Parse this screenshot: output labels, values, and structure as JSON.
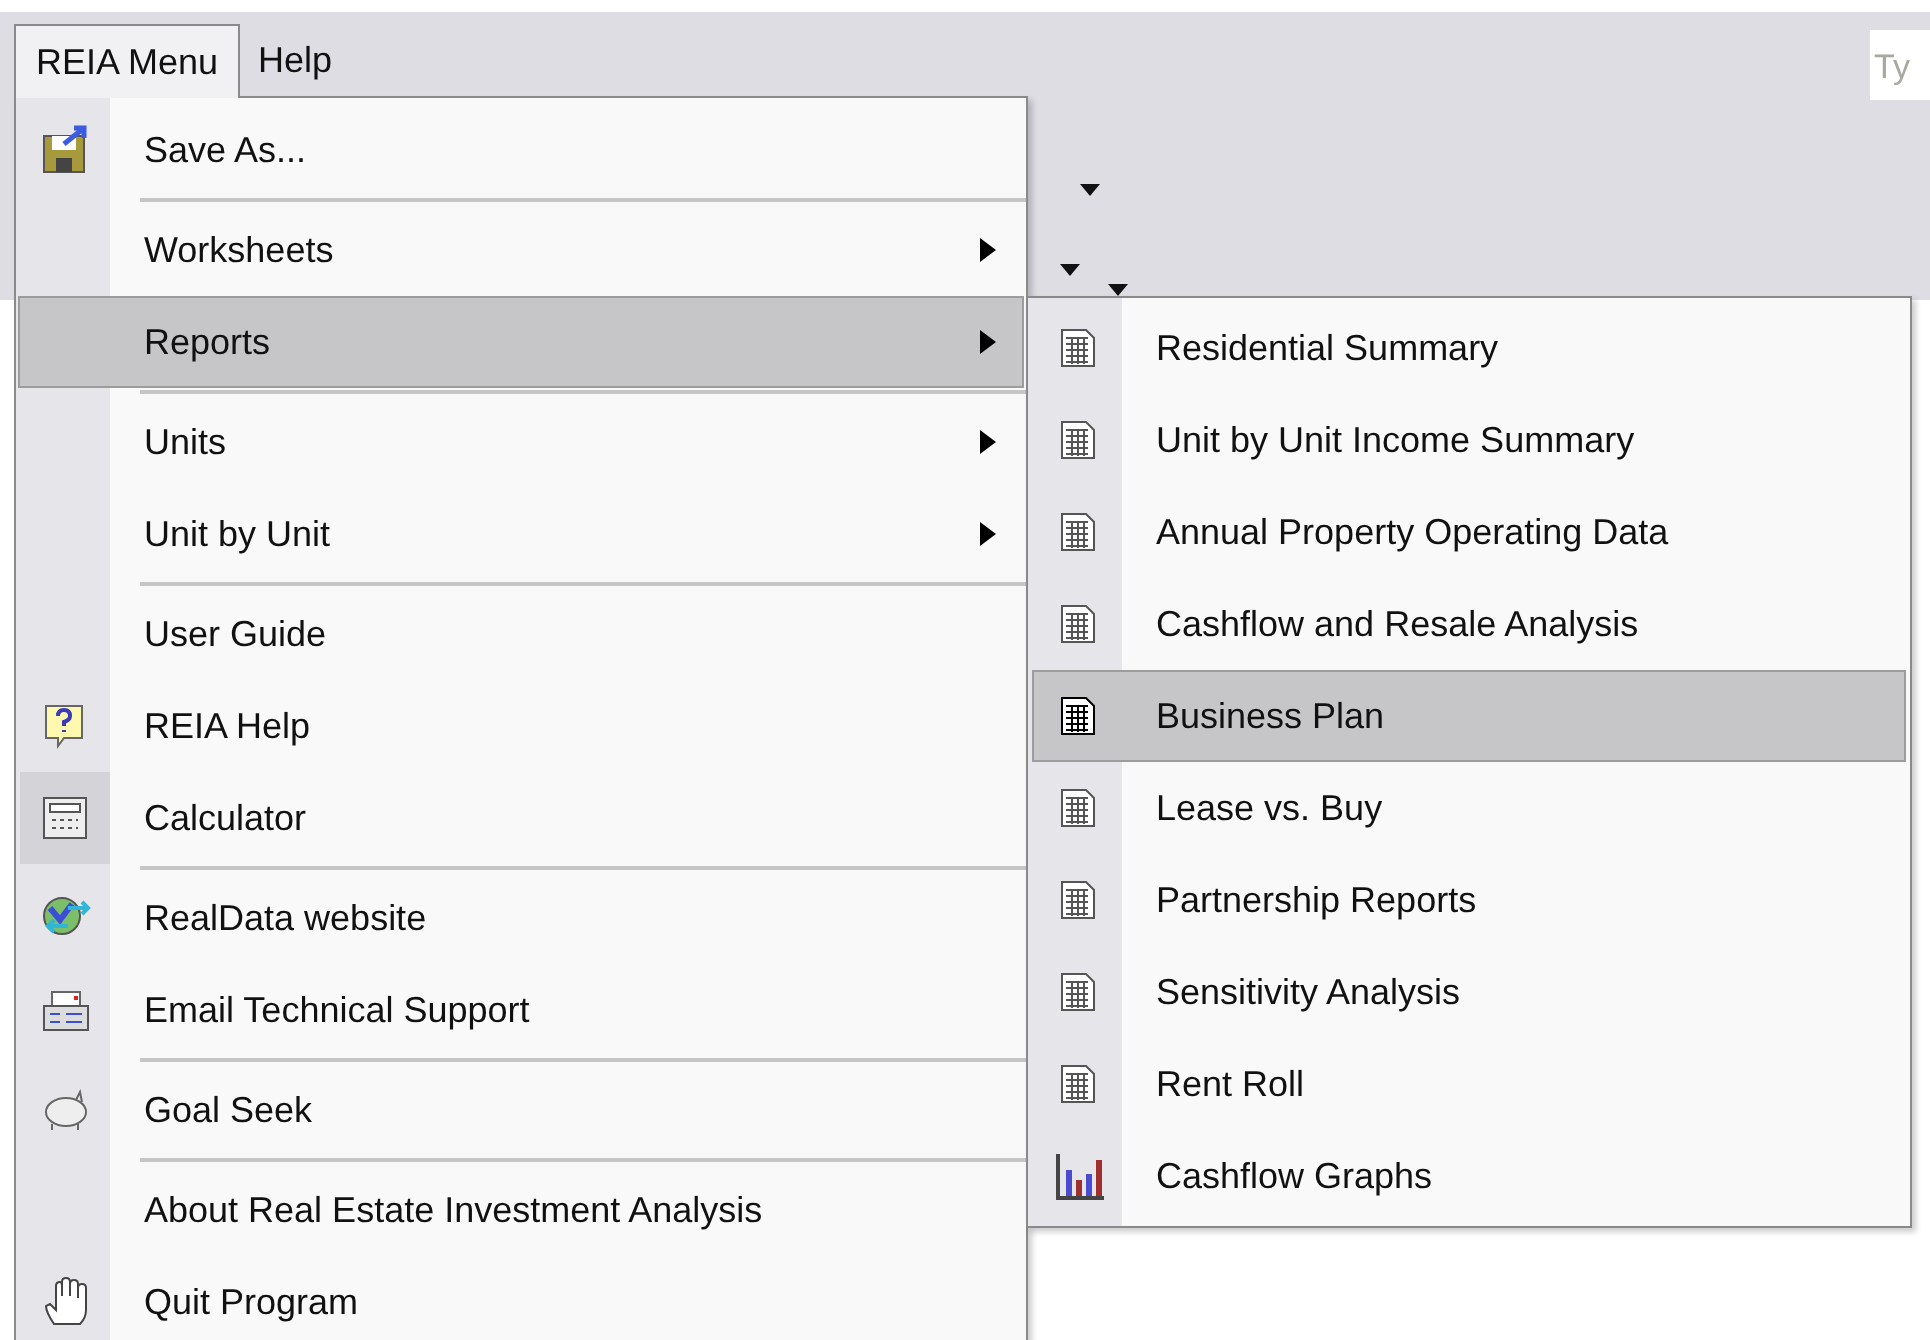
{
  "menu_bar": [
    {
      "label": "REIA Menu",
      "selected": true
    },
    {
      "label": "Help",
      "selected": false
    }
  ],
  "search": {
    "placeholder": "Ty"
  },
  "menu": [
    {
      "kind": "item",
      "label": "Save As...",
      "submenu": false,
      "selected": false,
      "checked": false
    },
    {
      "kind": "separator"
    },
    {
      "kind": "item",
      "label": "Worksheets",
      "submenu": true,
      "selected": false,
      "checked": false
    },
    {
      "kind": "item",
      "label": "Reports",
      "submenu": true,
      "selected": true,
      "checked": false
    },
    {
      "kind": "separator"
    },
    {
      "kind": "item",
      "label": "Units",
      "submenu": true,
      "selected": false,
      "checked": false
    },
    {
      "kind": "item",
      "label": "Unit by Unit",
      "submenu": true,
      "selected": false,
      "checked": false
    },
    {
      "kind": "separator"
    },
    {
      "kind": "item",
      "label": "User Guide",
      "submenu": false,
      "selected": false,
      "checked": false
    },
    {
      "kind": "item",
      "label": "REIA Help",
      "submenu": false,
      "selected": false,
      "checked": false
    },
    {
      "kind": "item",
      "label": "Calculator",
      "submenu": false,
      "selected": false,
      "checked": true
    },
    {
      "kind": "separator"
    },
    {
      "kind": "item",
      "label": "RealData website",
      "submenu": false,
      "selected": false,
      "checked": false
    },
    {
      "kind": "item",
      "label": "Email Technical Support",
      "submenu": false,
      "selected": false,
      "checked": false
    },
    {
      "kind": "separator"
    },
    {
      "kind": "item",
      "label": "Goal Seek",
      "submenu": false,
      "selected": false,
      "checked": false
    },
    {
      "kind": "separator"
    },
    {
      "kind": "item",
      "label": "About Real Estate Investment Analysis",
      "submenu": false,
      "selected": false,
      "checked": false
    },
    {
      "kind": "item",
      "label": "Quit Program",
      "submenu": false,
      "selected": false,
      "checked": false
    }
  ],
  "submenu": [
    {
      "label": "Residential Summary",
      "selected": false,
      "kind": "sheet"
    },
    {
      "label": "Unit by Unit Income Summary",
      "selected": false,
      "kind": "sheet"
    },
    {
      "label": "Annual Property Operating Data",
      "selected": false,
      "kind": "sheet"
    },
    {
      "label": "Cashflow and Resale Analysis",
      "selected": false,
      "kind": "sheet"
    },
    {
      "label": "Business Plan",
      "selected": true,
      "kind": "sheet"
    },
    {
      "label": "Lease vs. Buy",
      "selected": false,
      "kind": "sheet"
    },
    {
      "label": "Partnership Reports",
      "selected": false,
      "kind": "sheet"
    },
    {
      "label": "Sensitivity Analysis",
      "selected": false,
      "kind": "sheet"
    },
    {
      "label": "Rent Roll",
      "selected": false,
      "kind": "sheet"
    },
    {
      "label": "Cashflow Graphs",
      "selected": false,
      "kind": "chart"
    }
  ]
}
